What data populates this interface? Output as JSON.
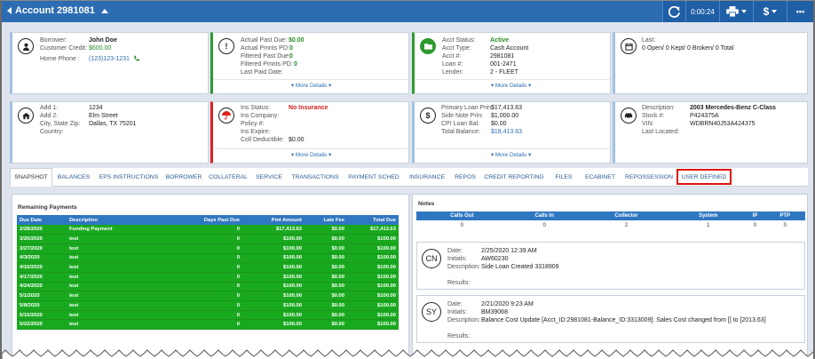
{
  "topbar": {
    "title": "Account 2981081",
    "timer": "0:00:24",
    "refresh_icon": "refresh-icon",
    "print_icon": "printer-icon",
    "dollar_label": "$",
    "more_label": "•••"
  },
  "cards": {
    "borrower": {
      "icon": "user-icon",
      "borrower_label": "Borrower:",
      "borrower": "John Doe",
      "credit_label": "Customer Credit:",
      "credit": "$600.00",
      "phone_label": "Home Phone :",
      "phone": "(123)123-1231"
    },
    "pastdue": {
      "icon": "alert-icon",
      "apd_label": "Actual Past Due:",
      "apd": "$0.00",
      "app_label": "Actual Pmnts PD:",
      "app": "0",
      "fpd_label": "Filtered Past Due:",
      "fpd": "0",
      "fpp_label": "Filtered Pmnts PD:",
      "fpp": "0",
      "lpd_label": "Last Paid Date:",
      "lpd": "",
      "more": "More Details"
    },
    "account": {
      "icon": "folder-icon",
      "status_label": "Acct Status:",
      "status": "Active",
      "type_label": "Acct Type:",
      "type": "Cash Account",
      "acct_label": "Acct #:",
      "acct": "2981081",
      "loan_label": "Loan #:",
      "loan": "001-2471",
      "lender_label": "Lender:",
      "lender": "2 - FLEET",
      "more": "More Details"
    },
    "last": {
      "icon": "calendar-icon",
      "last_label": "Last:",
      "summary": "0 Open/ 0 Kept/ 0 Broken/ 0 Total"
    },
    "address": {
      "icon": "home-icon",
      "add1_label": "Add 1:",
      "add1": "1234",
      "add2_label": "Add 2:",
      "add2": "Elm Street",
      "city_label": "City, State Zip:",
      "city": "Dallas, TX 75201",
      "country_label": "Country:",
      "country": ""
    },
    "insurance": {
      "icon": "umbrella-icon",
      "status_label": "Ins Status:",
      "status": "No Insurance",
      "company_label": "Ins Company:",
      "company": "",
      "policy_label": "Policy #:",
      "policy": "",
      "expire_label": "Ins Expire:",
      "expire": "",
      "deduct_label": "Coll Deductible:",
      "deduct": "$0.00",
      "more": "More Details"
    },
    "loan": {
      "icon": "dollar-icon",
      "prin_label": "Primary Loan Prin:",
      "prin": "$17,413.63",
      "side_label": "Side Note Prin:",
      "side": "$1,000.00",
      "cpi_label": "CPI Loan Bal:",
      "cpi": "$0.00",
      "total_label": "Total Balance:",
      "total": "$18,413.63",
      "more": "More Details"
    },
    "vehicle": {
      "icon": "car-icon",
      "desc_label": "Description:",
      "desc": "2003 Mercedes-Benz C-Class",
      "stock_label": "Stock #:",
      "stock": "P424375A",
      "vin_label": "VIN:",
      "vin": "WDBRN40J53A424375",
      "located_label": "Last Located:",
      "located": ""
    }
  },
  "tabs": [
    "SNAPSHOT",
    "BALANCES",
    "EPS INSTRUCTIONS",
    "BORROWER",
    "COLLATERAL",
    "SERVICE",
    "TRANSACTIONS",
    "PAYMENT SCHED",
    "INSURANCE",
    "REPOS",
    "CREDIT REPORTING",
    "FILES",
    "ECABINET",
    "REPOSSESSION",
    "USER DEFINED"
  ],
  "remaining": {
    "title": "Remaining Payments",
    "headers": [
      "Due Date",
      "Description",
      "Days Past Due",
      "Pmt Amount",
      "Late Fee",
      "Total Due"
    ],
    "rows": [
      [
        "2/28/2020",
        "Funding Payment",
        "0",
        "$17,413.63",
        "$0.00",
        "$17,413.63"
      ],
      [
        "3/20/2020",
        "test",
        "0",
        "$100.00",
        "$0.00",
        "$100.00"
      ],
      [
        "3/27/2020",
        "test",
        "0",
        "$100.00",
        "$0.00",
        "$100.00"
      ],
      [
        "4/3/2020",
        "test",
        "0",
        "$100.00",
        "$0.00",
        "$100.00"
      ],
      [
        "4/10/2020",
        "test",
        "0",
        "$100.00",
        "$0.00",
        "$100.00"
      ],
      [
        "4/17/2020",
        "test",
        "0",
        "$100.00",
        "$0.00",
        "$100.00"
      ],
      [
        "4/24/2020",
        "test",
        "0",
        "$100.00",
        "$0.00",
        "$100.00"
      ],
      [
        "5/1/2020",
        "test",
        "0",
        "$100.00",
        "$0.00",
        "$100.00"
      ],
      [
        "5/8/2020",
        "test",
        "0",
        "$100.00",
        "$0.00",
        "$100.00"
      ],
      [
        "5/15/2020",
        "test",
        "0",
        "$100.00",
        "$0.00",
        "$100.00"
      ],
      [
        "5/22/2020",
        "test",
        "0",
        "$100.00",
        "$0.00",
        "$100.00"
      ]
    ]
  },
  "notes": {
    "title": "Notes",
    "headers": [
      "Calls Out",
      "Calls In",
      "Collector",
      "System",
      "IP",
      "PTP"
    ],
    "counts": [
      "0",
      "0",
      "2",
      "1",
      "0",
      "0"
    ],
    "date_label": "Date:",
    "initials_label": "Initials:",
    "desc_label": "Description:",
    "results_label": "Results:",
    "items": [
      {
        "avatar": "CN",
        "date": "2/25/2020 12:39 AM",
        "initials": "AW60230",
        "description": "Side Loan Created 3318909"
      },
      {
        "avatar": "SY",
        "date": "2/21/2020 9:23 AM",
        "initials": "BM39068",
        "description": "Balance Cost Update [Acct_ID:2981081-Balance_ID:3313009]: Sales Cost changed from [] to [2013.63]"
      }
    ]
  },
  "colors": {
    "brand": "#2c6cb3",
    "green": "#19a91f",
    "red": "#d22222",
    "highlight": "#e01010"
  }
}
